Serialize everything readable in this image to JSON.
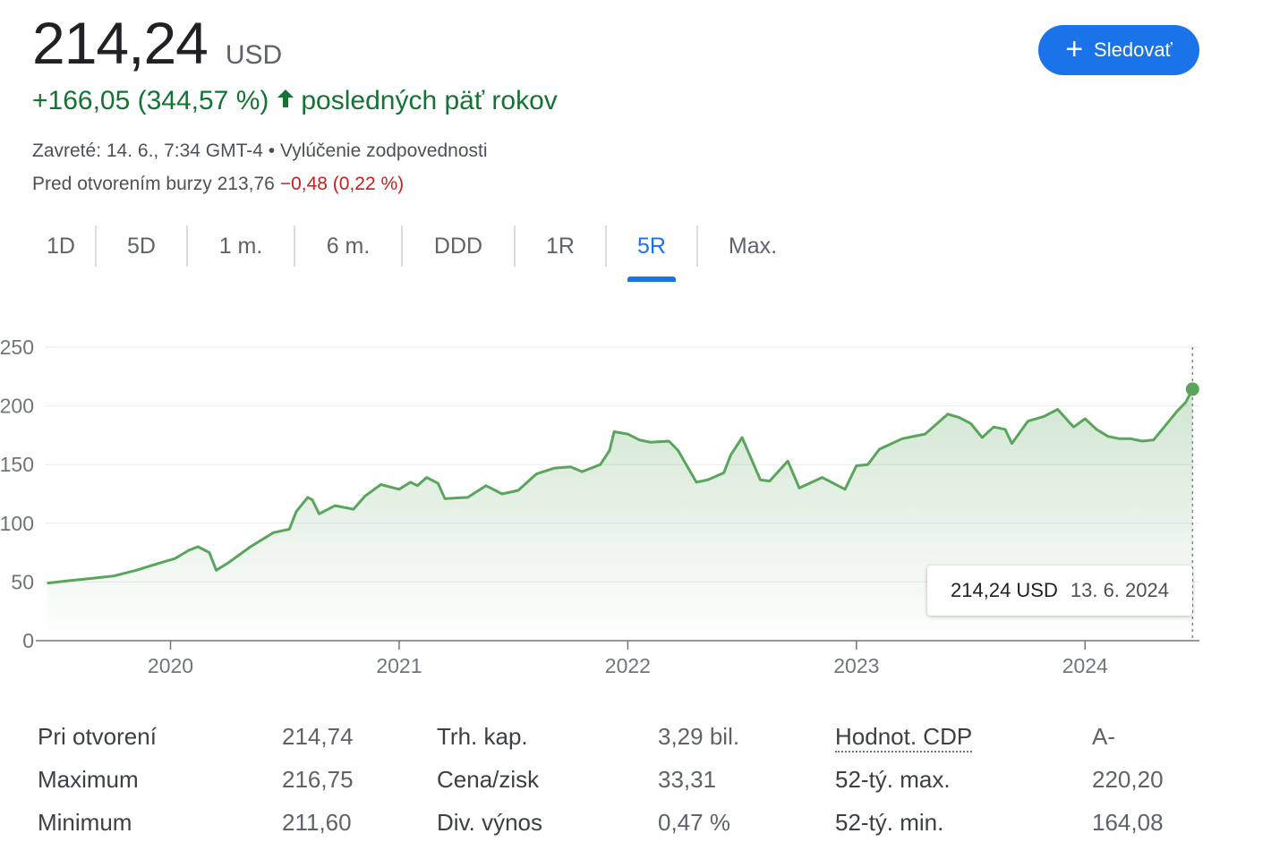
{
  "header": {
    "price": "214,24",
    "currency": "USD",
    "change": "+166,05 (344,57 %)",
    "change_arrow": "arrow-up-icon",
    "change_period": "posledných päť rokov",
    "closed_line": "Zavreté: 14. 6., 7:34 GMT-4 • Vylúčenie zodpovednosti",
    "premarket_label": "Pred otvorením burzy 213,76",
    "premarket_change": "−0,48 (0,22 %)",
    "follow_label": "Sledovať",
    "follow_icon": "plus-icon"
  },
  "colors": {
    "accent": "#1a73e8",
    "positive": "#137333",
    "negative": "#c5221f",
    "line": "#5aa55c"
  },
  "tabs": [
    {
      "label": "1D",
      "active": false
    },
    {
      "label": "5D",
      "active": false
    },
    {
      "label": "1 m.",
      "active": false
    },
    {
      "label": "6 m.",
      "active": false
    },
    {
      "label": "DDD",
      "active": false
    },
    {
      "label": "1R",
      "active": false
    },
    {
      "label": "5R",
      "active": true
    },
    {
      "label": "Max.",
      "active": false
    }
  ],
  "chart_data": {
    "type": "area",
    "title": "",
    "xlabel": "",
    "ylabel": "",
    "ylim": [
      0,
      250
    ],
    "yticks": [
      "0",
      "50",
      "100",
      "150",
      "200",
      "250"
    ],
    "xticks": [
      "2020",
      "2021",
      "2022",
      "2023",
      "2024"
    ],
    "xlim": [
      2019.45,
      2024.5
    ],
    "grid": true,
    "series": [
      {
        "x": [
          2019.46,
          2019.55,
          2019.65,
          2019.75,
          2019.85,
          2019.95,
          2020.02,
          2020.08,
          2020.12,
          2020.17,
          2020.2,
          2020.25,
          2020.35,
          2020.45,
          2020.52,
          2020.55,
          2020.6,
          2020.62,
          2020.65,
          2020.72,
          2020.8,
          2020.85,
          2020.92,
          2021.0,
          2021.05,
          2021.08,
          2021.12,
          2021.17,
          2021.2,
          2021.3,
          2021.38,
          2021.45,
          2021.52,
          2021.6,
          2021.68,
          2021.75,
          2021.8,
          2021.88,
          2021.92,
          2021.94,
          2022.0,
          2022.05,
          2022.1,
          2022.18,
          2022.22,
          2022.3,
          2022.35,
          2022.42,
          2022.45,
          2022.5,
          2022.58,
          2022.62,
          2022.7,
          2022.75,
          2022.85,
          2022.95,
          2023.0,
          2023.05,
          2023.1,
          2023.2,
          2023.3,
          2023.4,
          2023.45,
          2023.5,
          2023.55,
          2023.6,
          2023.65,
          2023.68,
          2023.75,
          2023.82,
          2023.88,
          2023.95,
          2024.0,
          2024.05,
          2024.1,
          2024.15,
          2024.2,
          2024.25,
          2024.3,
          2024.35,
          2024.4,
          2024.44,
          2024.47
        ],
        "values": [
          49,
          51,
          53,
          55,
          60,
          66,
          70,
          77,
          80,
          75,
          60,
          66,
          80,
          92,
          95,
          110,
          122,
          120,
          108,
          115,
          112,
          123,
          133,
          129,
          135,
          132,
          139,
          134,
          121,
          122,
          132,
          125,
          128,
          142,
          147,
          148,
          144,
          150,
          162,
          178,
          176,
          171,
          169,
          170,
          162,
          135,
          137,
          143,
          158,
          173,
          137,
          136,
          153,
          130,
          139,
          129,
          149,
          150,
          163,
          172,
          176,
          193,
          190,
          185,
          173,
          182,
          180,
          168,
          187,
          191,
          197,
          182,
          189,
          180,
          174,
          172,
          172,
          170,
          171,
          183,
          195,
          203,
          214.24
        ]
      }
    ],
    "last_point": {
      "x": "13. 6. 2024",
      "y": 214.24
    }
  },
  "tooltip": {
    "value": "214,24 USD",
    "date": "13. 6. 2024"
  },
  "stats": [
    {
      "label": "Pri otvorení",
      "value": "214,74"
    },
    {
      "label": "Maximum",
      "value": "216,75"
    },
    {
      "label": "Minimum",
      "value": "211,60"
    },
    {
      "label": "Trh. kap.",
      "value": "3,29 bil."
    },
    {
      "label": "Cena/zisk",
      "value": "33,31"
    },
    {
      "label": "Div. výnos",
      "value": "0,47 %"
    },
    {
      "label": "Hodnot. CDP",
      "value": "A-"
    },
    {
      "label": "52-tý. max.",
      "value": "220,20"
    },
    {
      "label": "52-tý. min.",
      "value": "164,08"
    }
  ]
}
